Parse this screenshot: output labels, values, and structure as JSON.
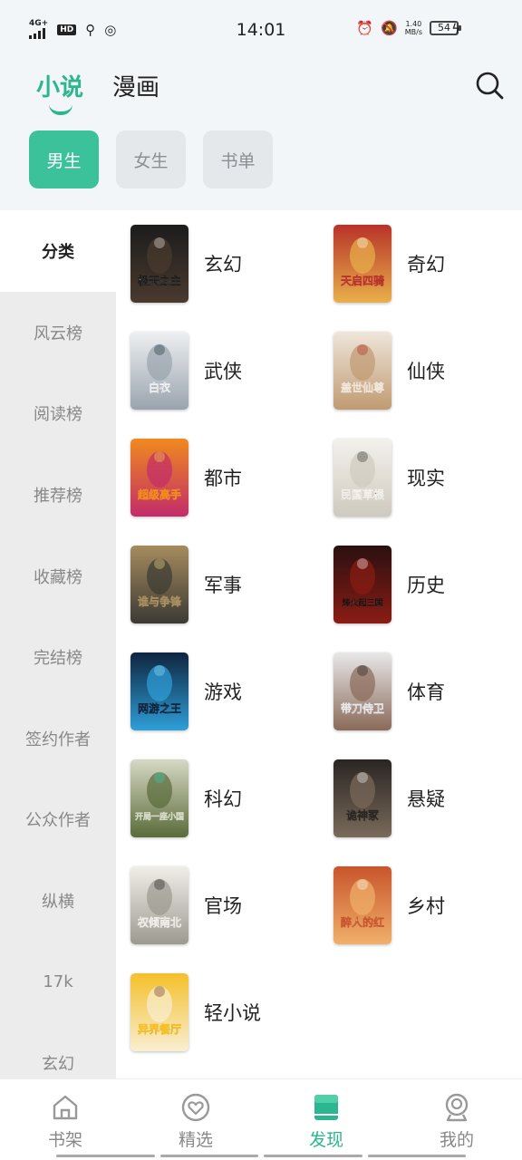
{
  "status_bar": {
    "network": "4G+",
    "hd": "HD",
    "time": "14:01",
    "speed_value": "1.40",
    "speed_unit": "MB/s",
    "battery": "54"
  },
  "header": {
    "tabs": [
      {
        "label": "小说",
        "active": true
      },
      {
        "label": "漫画",
        "active": false
      }
    ],
    "gender_tabs": [
      {
        "label": "男生",
        "active": true
      },
      {
        "label": "女生",
        "active": false
      },
      {
        "label": "书单",
        "active": false
      }
    ]
  },
  "side_nav": {
    "items": [
      {
        "label": "分类",
        "active": true
      },
      {
        "label": "风云榜"
      },
      {
        "label": "阅读榜"
      },
      {
        "label": "推荐榜"
      },
      {
        "label": "收藏榜"
      },
      {
        "label": "完结榜"
      },
      {
        "label": "签约作者"
      },
      {
        "label": "公众作者"
      },
      {
        "label": "纵横"
      },
      {
        "label": "17k"
      },
      {
        "label": "玄幻"
      }
    ]
  },
  "categories": [
    {
      "label": "玄幻",
      "cover_title": "极天之主",
      "colors": [
        "#1c1c1c",
        "#4a3a2e",
        "#f2f2f2"
      ]
    },
    {
      "label": "奇幻",
      "cover_title": "天启四骑",
      "colors": [
        "#b8322a",
        "#e8b04a",
        "#ffffff"
      ]
    },
    {
      "label": "武侠",
      "cover_title": "白衣",
      "colors": [
        "#eef0f2",
        "#9aa4ae",
        "#1e2a36"
      ]
    },
    {
      "label": "仙侠",
      "cover_title": "盖世仙尊",
      "colors": [
        "#efe6da",
        "#c09a72",
        "#b3231c"
      ]
    },
    {
      "label": "都市",
      "cover_title": "超级高手",
      "colors": [
        "#f08a1e",
        "#c22c6a",
        "#ffe14a"
      ]
    },
    {
      "label": "现实",
      "cover_title": "民国草根",
      "colors": [
        "#f3f1ec",
        "#cfcabf",
        "#2a2a2a"
      ]
    },
    {
      "label": "军事",
      "cover_title": "谁与争锋",
      "colors": [
        "#a68b5e",
        "#3b3a34",
        "#f5e08a"
      ]
    },
    {
      "label": "历史",
      "cover_title": "烽火起三国",
      "colors": [
        "#2a1010",
        "#8a1c14",
        "#ffffff"
      ]
    },
    {
      "label": "游戏",
      "cover_title": "网游之王",
      "colors": [
        "#0e2540",
        "#2f9fd8",
        "#9fe3ff"
      ]
    },
    {
      "label": "体育",
      "cover_title": "带刀侍卫",
      "colors": [
        "#e8e8ea",
        "#8a6a58",
        "#1a1a1a"
      ]
    },
    {
      "label": "科幻",
      "cover_title": "开局一座小国",
      "colors": [
        "#d7d9c4",
        "#5a6b3a",
        "#2bd0b0"
      ]
    },
    {
      "label": "悬疑",
      "cover_title": "诡神冢",
      "colors": [
        "#2a2522",
        "#7a6a5a",
        "#ffffff"
      ]
    },
    {
      "label": "官场",
      "cover_title": "权倾南北",
      "colors": [
        "#f0eee8",
        "#9c9a90",
        "#1a1a1a"
      ]
    },
    {
      "label": "乡村",
      "cover_title": "醉人的红",
      "colors": [
        "#c8552c",
        "#f0b06a",
        "#ffffff"
      ]
    },
    {
      "label": "轻小说",
      "cover_title": "异界餐厅",
      "colors": [
        "#f5c02a",
        "#f8eed2",
        "#6a2a1a"
      ]
    }
  ],
  "bottom_nav": {
    "items": [
      {
        "label": "书架",
        "icon": "house-icon",
        "active": false
      },
      {
        "label": "精选",
        "icon": "heart-badge-icon",
        "active": false
      },
      {
        "label": "发现",
        "icon": "book-icon",
        "active": true
      },
      {
        "label": "我的",
        "icon": "person-icon",
        "active": false
      }
    ]
  },
  "colors": {
    "accent": "#2bb68f",
    "accent_button": "#3cc29a"
  }
}
